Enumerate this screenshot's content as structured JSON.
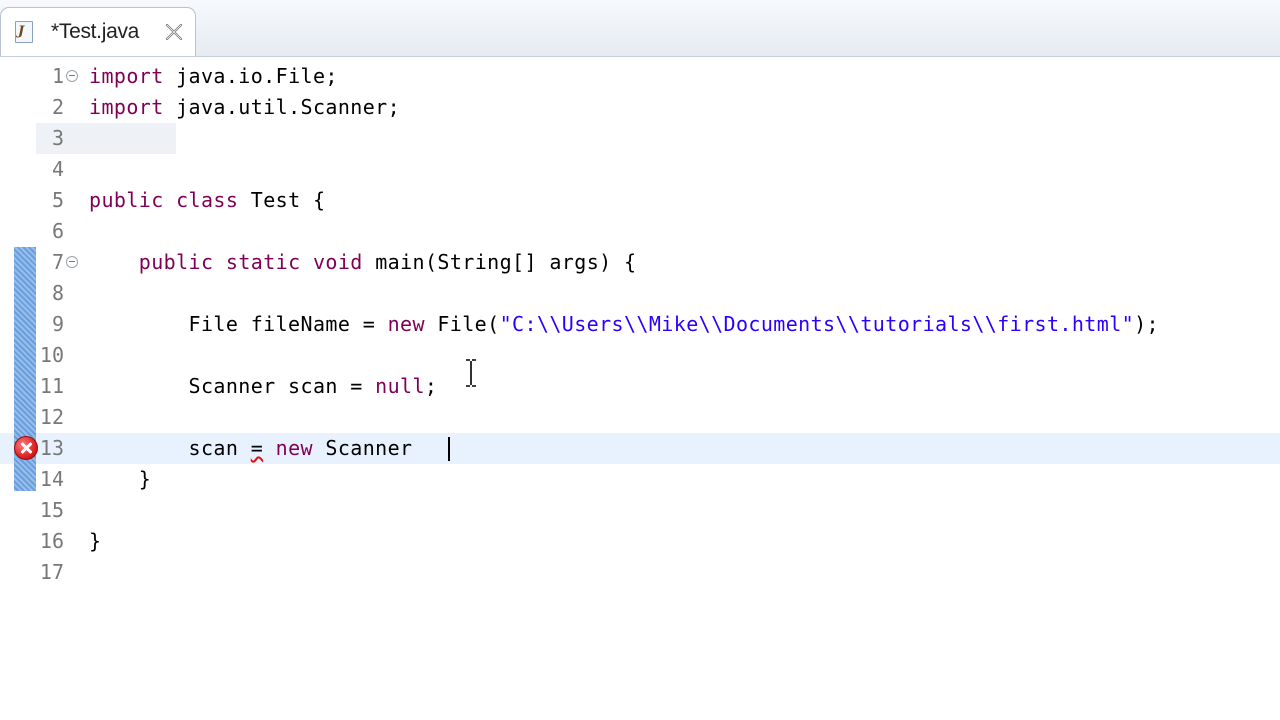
{
  "tab": {
    "title": "*Test.java",
    "file_icon_letter": "J",
    "close_icon": "close-icon"
  },
  "editor": {
    "lines": [
      {
        "num": "1",
        "text": "import java.io.File;"
      },
      {
        "num": "2",
        "text": "import java.util.Scanner;"
      },
      {
        "num": "3",
        "text": ""
      },
      {
        "num": "4",
        "text": ""
      },
      {
        "num": "5",
        "text": "public class Test {"
      },
      {
        "num": "6",
        "text": ""
      },
      {
        "num": "7",
        "text": "    public static void main(String[] args) {"
      },
      {
        "num": "8",
        "text": ""
      },
      {
        "num": "9",
        "text": "        File fileName = new File(\"C:\\\\Users\\\\Mike\\\\Documents\\\\tutorials\\\\first.html\");"
      },
      {
        "num": "10",
        "text": ""
      },
      {
        "num": "11",
        "text": "        Scanner scan = null;"
      },
      {
        "num": "12",
        "text": ""
      },
      {
        "num": "13",
        "text": "        scan = new Scanner"
      },
      {
        "num": "14",
        "text": "    }"
      },
      {
        "num": "15",
        "text": ""
      },
      {
        "num": "16",
        "text": "}"
      },
      {
        "num": "17",
        "text": ""
      }
    ],
    "current_line": "13",
    "error_line": "13"
  },
  "colors": {
    "keyword": "#7f0055",
    "string": "#2a00ff",
    "line_number": "#787878",
    "current_line_bg": "#e8f2fe",
    "error": "#d41818"
  }
}
